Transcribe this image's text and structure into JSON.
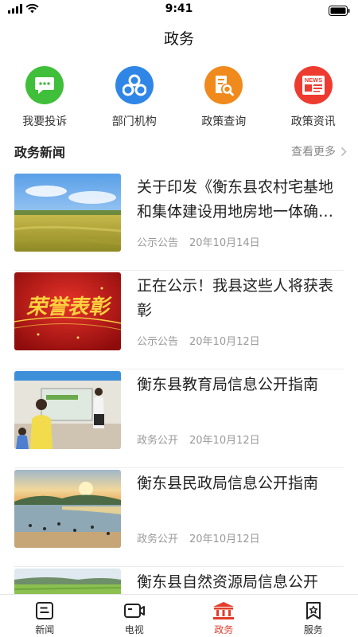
{
  "status_bar": {
    "time": "9:41"
  },
  "page_title": "政务",
  "quick_actions": [
    {
      "label": "我要投诉",
      "icon": "chat-bubble-icon",
      "color": "#3fbf3a"
    },
    {
      "label": "部门机构",
      "icon": "organization-icon",
      "color": "#2f86e6"
    },
    {
      "label": "政策查询",
      "icon": "document-search-icon",
      "color": "#f08a1c"
    },
    {
      "label": "政策资讯",
      "icon": "news-icon",
      "color": "#ee3b30"
    }
  ],
  "section": {
    "title": "政务新闻",
    "more_label": "查看更多"
  },
  "news": [
    {
      "title": "关于印发《衡东县农村宅基地和集体建设用地房地一体确权登记颁证工作实施方案》的通知",
      "category": "公示公告",
      "date": "20年10月14日",
      "thumb": "rice-field"
    },
    {
      "title": "正在公示！我县这些人将获表彰",
      "category": "公示公告",
      "date": "20年10月12日",
      "thumb": "honor-banner",
      "thumb_text": "荣誉表彰"
    },
    {
      "title": "衡东县教育局信息公开指南",
      "category": "政务公开",
      "date": "20年10月12日",
      "thumb": "classroom"
    },
    {
      "title": "衡东县民政局信息公开指南",
      "category": "政务公开",
      "date": "20年10月12日",
      "thumb": "lake-sunset"
    },
    {
      "title": "衡东县自然资源局信息公开",
      "category": "",
      "date": "",
      "thumb": "farmland"
    }
  ],
  "tab_bar": {
    "active_color": "#e23d2a",
    "tabs": [
      {
        "label": "新闻",
        "icon": "news-tab-icon"
      },
      {
        "label": "电视",
        "icon": "tv-tab-icon"
      },
      {
        "label": "政务",
        "icon": "government-building-icon",
        "active": true
      },
      {
        "label": "服务",
        "icon": "service-tab-icon"
      }
    ]
  }
}
